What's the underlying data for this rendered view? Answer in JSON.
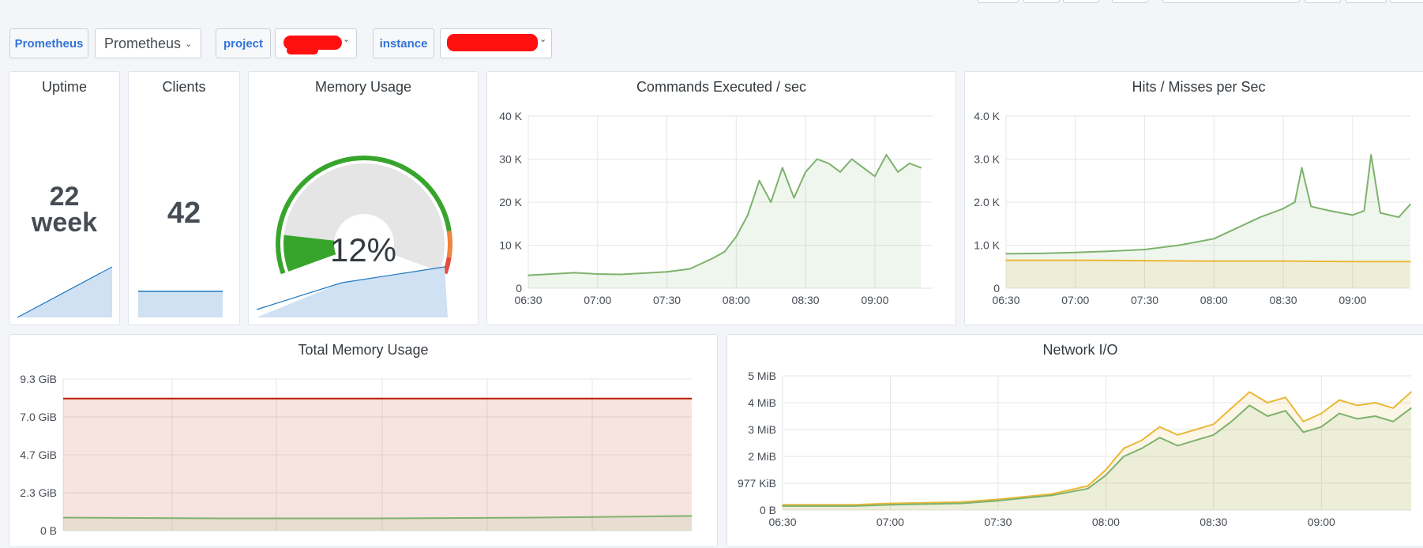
{
  "toolbar": {
    "datasource_label": "Prometheus",
    "datasource_value": "Prometheus",
    "project_label": "project",
    "instance_label": "instance"
  },
  "uptime": {
    "title": "Uptime",
    "value": "22",
    "unit": "week"
  },
  "clients": {
    "title": "Clients",
    "value": "42"
  },
  "memory_gauge": {
    "title": "Memory Usage",
    "value": "12%",
    "percent": 12
  },
  "colors": {
    "green": "#7eb26d",
    "yellow": "#eab839",
    "red": "#bf1b00",
    "blue": "#1f78c1",
    "gauge_green": "#37a52c",
    "gauge_orange": "#ef843c",
    "gauge_red": "#e24d42"
  },
  "commands_chart": {
    "title": "Commands Executed / sec"
  },
  "hits_chart": {
    "title": "Hits / Misses per Sec"
  },
  "total_memory_chart": {
    "title": "Total Memory Usage"
  },
  "network_chart": {
    "title": "Network I/O"
  },
  "chart_data": [
    {
      "type": "area",
      "title": "Commands Executed / sec",
      "x_ticks": [
        "06:30",
        "07:00",
        "07:30",
        "08:00",
        "08:30",
        "09:00"
      ],
      "y_ticks": [
        "0",
        "10 K",
        "20 K",
        "30 K",
        "40 K"
      ],
      "ylim": [
        0,
        40000
      ],
      "grid": true,
      "series": [
        {
          "color": "#7eb26d",
          "x": [
            "06:30",
            "06:40",
            "06:50",
            "07:00",
            "07:10",
            "07:20",
            "07:30",
            "07:40",
            "07:50",
            "07:55",
            "08:00",
            "08:05",
            "08:10",
            "08:15",
            "08:20",
            "08:25",
            "08:30",
            "08:35",
            "08:40",
            "08:45",
            "08:50",
            "08:55",
            "09:00",
            "09:05",
            "09:10",
            "09:15",
            "09:20"
          ],
          "values": [
            3000,
            3300,
            3600,
            3300,
            3200,
            3500,
            3800,
            4500,
            7000,
            8500,
            12000,
            17000,
            25000,
            20000,
            28000,
            21000,
            27000,
            30000,
            29000,
            27000,
            30000,
            28000,
            26000,
            31000,
            27000,
            29000,
            28000
          ]
        }
      ]
    },
    {
      "type": "area",
      "title": "Hits / Misses per Sec",
      "x_ticks": [
        "06:30",
        "07:00",
        "07:30",
        "08:00",
        "08:30",
        "09:00"
      ],
      "y_ticks": [
        "0",
        "1.0 K",
        "2.0 K",
        "3.0 K",
        "4.0 K"
      ],
      "ylim": [
        0,
        4000
      ],
      "grid": true,
      "series": [
        {
          "color": "#7eb26d",
          "x": [
            "06:30",
            "06:45",
            "07:00",
            "07:15",
            "07:30",
            "07:45",
            "08:00",
            "08:10",
            "08:20",
            "08:30",
            "08:35",
            "08:38",
            "08:42",
            "08:50",
            "09:00",
            "09:05",
            "09:08",
            "09:12",
            "09:20",
            "09:25"
          ],
          "values": [
            800,
            810,
            830,
            860,
            900,
            1000,
            1150,
            1400,
            1650,
            1850,
            2000,
            2800,
            1900,
            1800,
            1700,
            1800,
            3100,
            1750,
            1650,
            1950
          ]
        },
        {
          "color": "#eab839",
          "x": [
            "06:30",
            "07:00",
            "07:30",
            "08:00",
            "08:30",
            "09:00",
            "09:25"
          ],
          "values": [
            650,
            650,
            640,
            630,
            630,
            620,
            620
          ]
        }
      ]
    },
    {
      "type": "area",
      "title": "Total Memory Usage",
      "y_ticks": [
        "0 B",
        "2.3 GiB",
        "4.7 GiB",
        "7.0 GiB",
        "9.3 GiB"
      ],
      "ylim_gib": [
        0,
        9.3
      ],
      "grid": true,
      "series": [
        {
          "color": "#bf1b00",
          "values": [
            8.1,
            8.1
          ]
        },
        {
          "color": "#7eb26d",
          "values": [
            0.8,
            0.75,
            0.75,
            0.8,
            0.9
          ]
        }
      ]
    },
    {
      "type": "area",
      "title": "Network I/O",
      "x_ticks": [
        "06:30",
        "07:00",
        "07:30",
        "08:00",
        "08:30",
        "09:00"
      ],
      "y_ticks": [
        "0 B",
        "977 KiB",
        "2 MiB",
        "3 MiB",
        "4 MiB",
        "5 MiB"
      ],
      "ylim_mib": [
        0,
        5
      ],
      "grid": true,
      "series": [
        {
          "color": "#eab839",
          "x": [
            "06:30",
            "06:50",
            "07:00",
            "07:20",
            "07:30",
            "07:45",
            "07:55",
            "08:00",
            "08:05",
            "08:10",
            "08:15",
            "08:20",
            "08:25",
            "08:30",
            "08:35",
            "08:40",
            "08:45",
            "08:50",
            "08:55",
            "09:00",
            "09:05",
            "09:10",
            "09:15",
            "09:20",
            "09:25"
          ],
          "values": [
            0.2,
            0.2,
            0.25,
            0.3,
            0.4,
            0.6,
            0.9,
            1.5,
            2.3,
            2.6,
            3.1,
            2.8,
            3.0,
            3.2,
            3.8,
            4.4,
            4.0,
            4.2,
            3.3,
            3.6,
            4.1,
            3.9,
            4.0,
            3.8,
            4.4
          ]
        },
        {
          "color": "#7eb26d",
          "x": [
            "06:30",
            "06:50",
            "07:00",
            "07:20",
            "07:30",
            "07:45",
            "07:55",
            "08:00",
            "08:05",
            "08:10",
            "08:15",
            "08:20",
            "08:25",
            "08:30",
            "08:35",
            "08:40",
            "08:45",
            "08:50",
            "08:55",
            "09:00",
            "09:05",
            "09:10",
            "09:15",
            "09:20",
            "09:25"
          ],
          "values": [
            0.15,
            0.15,
            0.2,
            0.25,
            0.35,
            0.55,
            0.8,
            1.3,
            2.0,
            2.3,
            2.7,
            2.4,
            2.6,
            2.8,
            3.3,
            3.9,
            3.5,
            3.7,
            2.9,
            3.1,
            3.6,
            3.4,
            3.5,
            3.3,
            3.8
          ]
        }
      ]
    }
  ]
}
